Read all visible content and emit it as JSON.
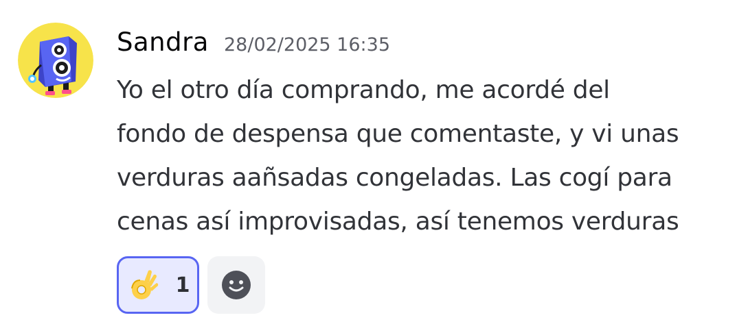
{
  "message": {
    "author": "Sandra",
    "timestamp": "28/02/2025 16:35",
    "content_lines": [
      "Yo el otro día comprando, me acordé del",
      "fondo de despensa que comentaste, y vi unas",
      "verduras aañsadas congeladas. Las cogí para",
      "cenas así improvisadas, así tenemos verduras"
    ],
    "avatar": {
      "icon": "speaker-character-icon",
      "background_color": "#f7e34a",
      "figure_color": "#5865f2"
    },
    "reactions": [
      {
        "emoji": "ok-hand-emoji-icon",
        "count": "1",
        "selected": true,
        "accent_color": "#5865f2"
      }
    ],
    "add_reaction_icon": "smiley-add-reaction-icon"
  }
}
